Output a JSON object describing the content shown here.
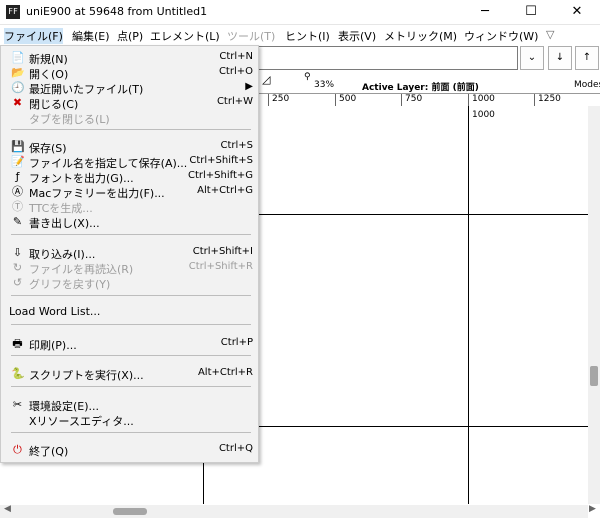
{
  "window": {
    "title": "uniE900 at 59648 from Untitled1",
    "app_icon_text": "FF",
    "min_glyph": "─",
    "max_glyph": "☐",
    "close_glyph": "✕"
  },
  "menubar": {
    "items": [
      {
        "label": "ファイル(F)",
        "active": true
      },
      {
        "label": "編集(E)"
      },
      {
        "label": "点(P)"
      },
      {
        "label": "エレメント(L)"
      },
      {
        "label": "ツール(T)",
        "disabled": true
      },
      {
        "label": "ヒント(I)"
      },
      {
        "label": "表示(V)"
      },
      {
        "label": "メトリック(M)"
      },
      {
        "label": "ウィンドウ(W)"
      }
    ],
    "overflow_glyph": "▽"
  },
  "toolbar": {
    "dropdown_glyph": "⌄",
    "btn1_glyph": "↓",
    "btn2_glyph": "↑"
  },
  "status": {
    "zoom": "33%",
    "active_layer": "Active Layer: 前面 (前面)",
    "modes": "Modes"
  },
  "ruler": {
    "labels": [
      "250",
      "500",
      "750",
      "1000",
      "1250"
    ]
  },
  "canvas": {
    "label_1000": "1000"
  },
  "file_menu": {
    "items": [
      {
        "icon": "📄",
        "icon_name": "new-file-icon",
        "label": "新規(N)",
        "shortcut": "Ctrl+N"
      },
      {
        "icon": "📂",
        "icon_name": "open-folder-icon",
        "label": "開く(O)",
        "shortcut": "Ctrl+O"
      },
      {
        "icon": "🕘",
        "icon_name": "recent-files-icon",
        "label": "最近開いたファイル(T)",
        "shortcut": "▶"
      },
      {
        "icon": "✖",
        "icon_name": "close-file-icon",
        "label": "閉じる(C)",
        "shortcut": "Ctrl+W"
      },
      {
        "icon": "",
        "icon_name": "",
        "label": "タブを閉じる(L)",
        "shortcut": "",
        "disabled": true
      },
      {
        "icon": "💾",
        "icon_name": "save-icon",
        "label": "保存(S)",
        "shortcut": "Ctrl+S"
      },
      {
        "icon": "📝",
        "icon_name": "save-as-icon",
        "label": "ファイル名を指定して保存(A)...",
        "shortcut": "Ctrl+Shift+S"
      },
      {
        "icon": "ƒ",
        "icon_name": "generate-fonts-icon",
        "label": "フォントを出力(G)...",
        "shortcut": "Ctrl+Shift+G"
      },
      {
        "icon": "Ⓐ",
        "icon_name": "generate-mac-family-icon",
        "label": "Macファミリーを出力(F)...",
        "shortcut": "Alt+Ctrl+G"
      },
      {
        "icon": "Ⓣ",
        "icon_name": "generate-ttc-icon",
        "label": "TTCを生成...",
        "shortcut": "",
        "disabled": true
      },
      {
        "icon": "✎",
        "icon_name": "export-icon",
        "label": "書き出し(X)...",
        "shortcut": ""
      },
      {
        "icon": "⇩",
        "icon_name": "import-icon",
        "label": "取り込み(I)...",
        "shortcut": "Ctrl+Shift+I"
      },
      {
        "icon": "↻",
        "icon_name": "revert-file-icon",
        "label": "ファイルを再読込(R)",
        "shortcut": "Ctrl+Shift+R",
        "disabled": true
      },
      {
        "icon": "↺",
        "icon_name": "revert-glyph-icon",
        "label": "グリフを戻す(Y)",
        "shortcut": "",
        "disabled": true
      },
      {
        "icon": "",
        "icon_name": "",
        "label": "Load Word List...",
        "shortcut": ""
      },
      {
        "icon": "🖶",
        "icon_name": "print-icon",
        "label": "印刷(P)...",
        "shortcut": "Ctrl+P"
      },
      {
        "icon": "🐍",
        "icon_name": "python-script-icon",
        "label": "スクリプトを実行(X)...",
        "shortcut": "Alt+Ctrl+R"
      },
      {
        "icon": "✂",
        "icon_name": "preferences-icon",
        "label": "環境設定(E)...",
        "shortcut": ""
      },
      {
        "icon": "",
        "icon_name": "",
        "label": "Xリソースエディタ...",
        "shortcut": ""
      },
      {
        "icon": "⏻",
        "icon_name": "quit-icon",
        "label": "終了(Q)",
        "shortcut": "Ctrl+Q"
      }
    ]
  }
}
